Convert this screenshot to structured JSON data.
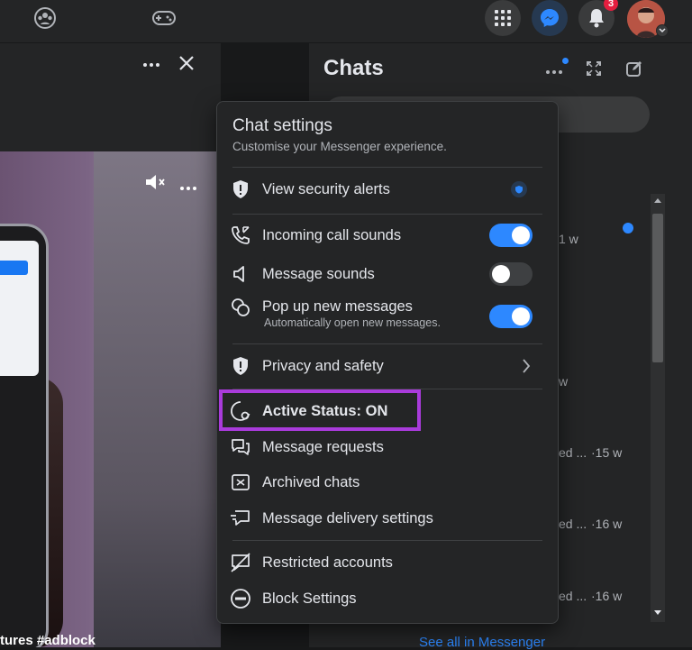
{
  "topbar": {
    "notification_badge": "3"
  },
  "video": {
    "caption": "tures #adblock"
  },
  "chats": {
    "title": "Chats",
    "times": [
      "1 w",
      "w",
      "·15 w",
      "·16 w",
      "·16 w"
    ],
    "snippets": [
      "ed ...",
      "ed ...",
      "ed ..."
    ],
    "see_all": "See all in Messenger"
  },
  "settings": {
    "title": "Chat settings",
    "subtitle": "Customise your Messenger experience.",
    "items": [
      {
        "label": "View security alerts",
        "icon": "shield-alert-icon"
      },
      {
        "label": "Incoming call sounds",
        "icon": "phone-call-icon",
        "toggle": true
      },
      {
        "label": "Message sounds",
        "icon": "speaker-icon",
        "toggle": false
      },
      {
        "label": "Pop up new messages",
        "icon": "bubbles-icon",
        "toggle": true,
        "description": "Automatically open new messages."
      },
      {
        "label": "Privacy and safety",
        "icon": "shield-icon"
      },
      {
        "label": "Active Status: ON",
        "icon": "active-status-icon"
      },
      {
        "label": "Message requests",
        "icon": "message-requests-icon"
      },
      {
        "label": "Archived chats",
        "icon": "archive-icon"
      },
      {
        "label": "Message delivery settings",
        "icon": "delivery-icon"
      },
      {
        "label": "Restricted accounts",
        "icon": "restricted-icon"
      },
      {
        "label": "Block Settings",
        "icon": "block-icon"
      }
    ]
  },
  "colors": {
    "accent": "#2d88ff",
    "highlight": "#a93bdb",
    "badge": "#e41e3f"
  }
}
